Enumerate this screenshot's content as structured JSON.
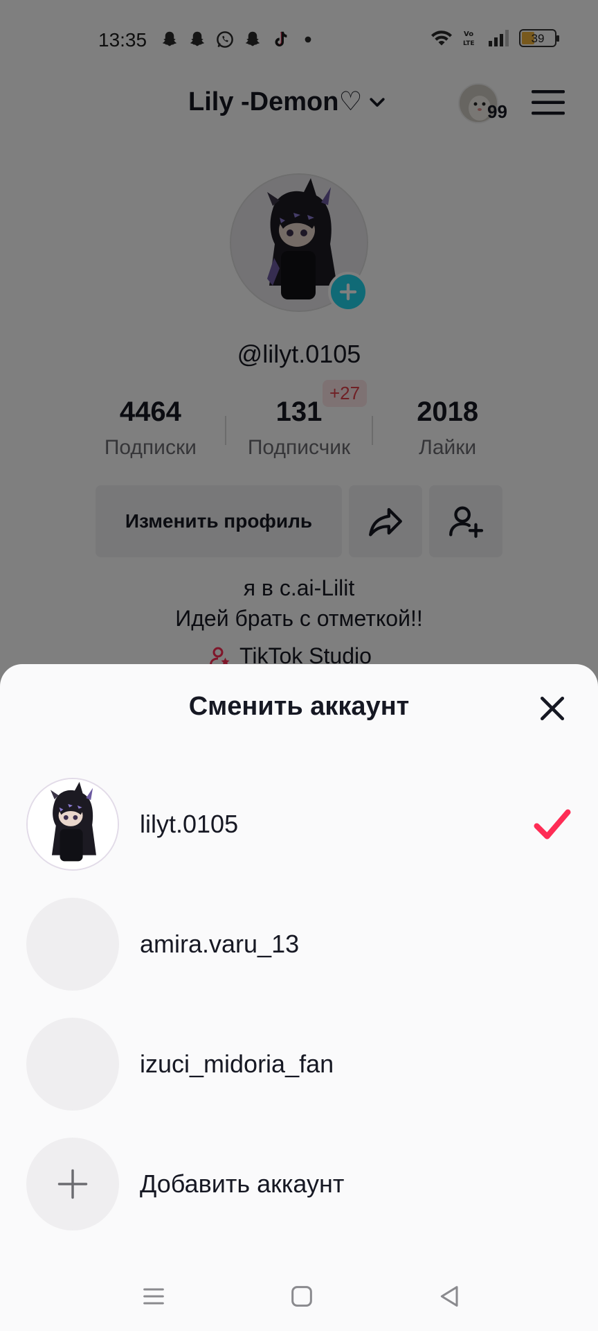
{
  "status_bar": {
    "time": "13:35",
    "app_icons": [
      "snapchat-icon",
      "snapchat-icon",
      "whatsapp-icon",
      "snapchat-icon",
      "tiktok-icon",
      "dot-icon"
    ],
    "right_icons": [
      "wifi-icon",
      "volte-icon",
      "signal-icon"
    ],
    "volte_label": "Vo\nLTE",
    "battery": "39",
    "battery_level": 0.39
  },
  "profile": {
    "display_name": "Lily -Demon♡",
    "story_count": "99",
    "handle": "@lilyt.0105",
    "stats": [
      {
        "value": "4464",
        "label": "Подписки"
      },
      {
        "value": "131",
        "label": "Подписчик"
      },
      {
        "value": "2018",
        "label": "Лайки"
      }
    ],
    "new_followers": "+27",
    "edit_button": "Изменить профиль",
    "bio_line1": "я в c.ai-Lilit",
    "bio_line2": "Идей брать с отметкой!!",
    "studio_link": "TikTok Studio"
  },
  "sheet": {
    "title": "Сменить аккаунт",
    "accounts": [
      {
        "name": "lilyt.0105",
        "selected": true
      },
      {
        "name": "amira.varu_13",
        "selected": false
      },
      {
        "name": "izuci_midoria_fan",
        "selected": false
      }
    ],
    "add_account": "Добавить аккаунт"
  },
  "colors": {
    "accent_red": "#fe2c55",
    "plus_badge": "#20d5ec",
    "dim_overlay": "rgba(0,0,0,0.5)"
  }
}
